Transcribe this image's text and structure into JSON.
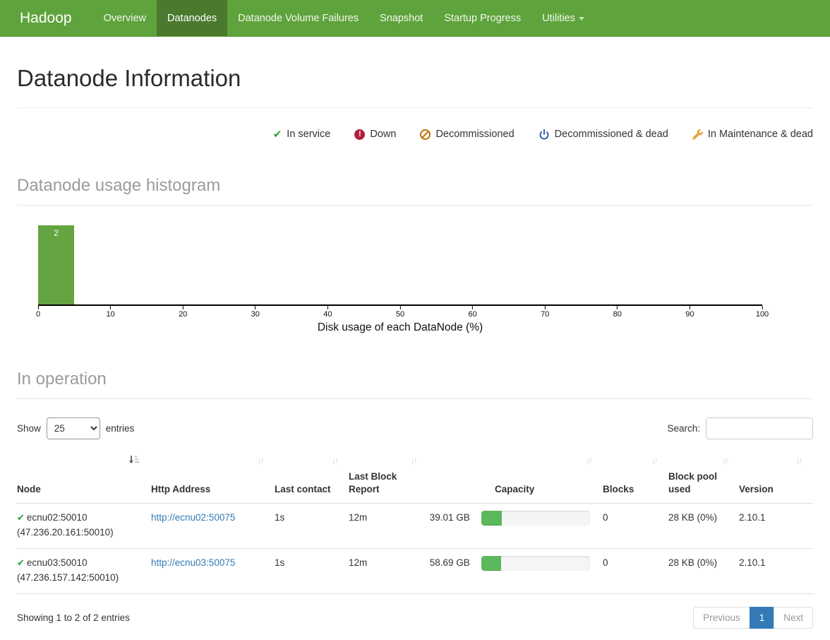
{
  "navbar": {
    "brand": "Hadoop",
    "items": [
      {
        "label": "Overview",
        "active": false
      },
      {
        "label": "Datanodes",
        "active": true
      },
      {
        "label": "Datanode Volume Failures",
        "active": false
      },
      {
        "label": "Snapshot",
        "active": false
      },
      {
        "label": "Startup Progress",
        "active": false
      },
      {
        "label": "Utilities",
        "active": false,
        "has_dropdown": true
      }
    ]
  },
  "page": {
    "title": "Datanode Information"
  },
  "legend": [
    {
      "icon": "check-icon",
      "label": "In service",
      "color": "#28a12c"
    },
    {
      "icon": "alert-circle-icon",
      "label": "Down",
      "color": "#b21e3f"
    },
    {
      "icon": "ban-icon",
      "label": "Decommissioned",
      "color": "#c06e00"
    },
    {
      "icon": "power-icon",
      "label": "Decommissioned & dead",
      "color": "#2456a4"
    },
    {
      "icon": "wrench-icon",
      "label": "In Maintenance & dead",
      "color": "#e8a33d"
    }
  ],
  "sections": {
    "histogram_title": "Datanode usage histogram",
    "operation_title": "In operation"
  },
  "chart_data": {
    "type": "bar",
    "title": "Datanode usage histogram",
    "xlabel": "Disk usage of each DataNode (%)",
    "ylabel": "",
    "xlim": [
      0,
      100
    ],
    "grid": false,
    "bins": [
      {
        "x0": 0,
        "x1": 5,
        "count": 2
      }
    ],
    "bar_value_label": "2",
    "bar_color": "#64a441",
    "ticks": [
      0,
      10,
      20,
      30,
      40,
      50,
      60,
      70,
      80,
      90,
      100
    ]
  },
  "controls": {
    "show_label": "Show",
    "page_size": "25",
    "entries_label": "entries",
    "search_label": "Search:",
    "search_value": ""
  },
  "table": {
    "columns": [
      "Node",
      "Http Address",
      "Last contact",
      "Last Block Report",
      "Capacity",
      "Blocks",
      "Block pool used",
      "Version"
    ],
    "rows": [
      {
        "node": "ecnu02:50010",
        "node_ip": "(47.236.20.161:50010)",
        "status": "in-service",
        "http_address": "http://ecnu02:50075",
        "last_contact": "1s",
        "last_block_report": "12m",
        "capacity": "39.01 GB",
        "capacity_bar_style": "width:19%",
        "blocks": "0",
        "block_pool_used": "28 KB (0%)",
        "version": "2.10.1"
      },
      {
        "node": "ecnu03:50010",
        "node_ip": "(47.236.157.142:50010)",
        "status": "in-service",
        "http_address": "http://ecnu03:50075",
        "last_contact": "1s",
        "last_block_report": "12m",
        "capacity": "58.69 GB",
        "capacity_bar_style": "width:18%",
        "blocks": "0",
        "block_pool_used": "28 KB (0%)",
        "version": "2.10.1"
      }
    ]
  },
  "footer": {
    "info": "Showing 1 to 2 of 2 entries",
    "pagination": {
      "previous": "Previous",
      "page": "1",
      "next": "Next"
    }
  },
  "colors": {
    "navbar_green": "#5fa33c",
    "active_tab_green": "#4b7a2e",
    "link_blue": "#337ab7",
    "histogram_bar_green": "#64a441",
    "progress_green": "#5cb85c",
    "pagination_active_blue": "#337ab7"
  }
}
